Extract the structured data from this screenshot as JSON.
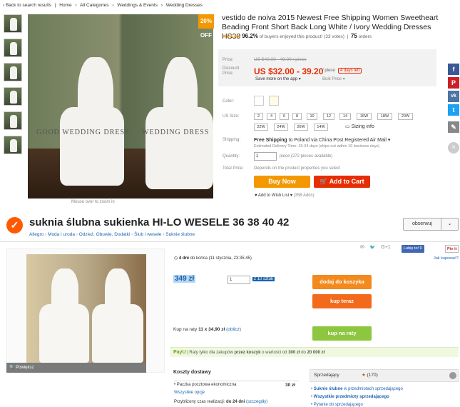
{
  "aliexpress": {
    "breadcrumb": [
      "‹ Back to search results",
      "|",
      "Home",
      "›",
      "All Categories",
      "›",
      "Weddings & Events",
      "›",
      "Wedding Dresses"
    ],
    "discount_badge": "20% OFF",
    "watermarks": [
      "GOOD WEDDING DRESS",
      "WEDDING DRESS"
    ],
    "zoom_hint": "Mouse over to zoom in",
    "title": "vestido de noiva 2015 Newest Free Shipping Women Sweetheart Beading Front Short Back Long White / Ivory Wedding Dresses HS30",
    "rating": {
      "stars": "★★★★★",
      "percent": "96.2%",
      "text": "of buyers enjoyed this product! (33 votes)",
      "orders_count": "75",
      "orders_label": "orders"
    },
    "price": {
      "price_label": "Price:",
      "old": "US $40.00 - 49.00 / piece",
      "discount_label": "Discount Price:",
      "new": "US $32.00 - 39.20",
      "unit": "/ piece",
      "days_left": "4 days left",
      "app_save": "Save more on the app ▾",
      "bulk": "Bulk Price ▾"
    },
    "labels": {
      "color": "Color:",
      "size": "US Size:",
      "shipping": "Shipping:",
      "quantity": "Quantity:",
      "total": "Total Price:"
    },
    "sizes": [
      "2",
      "4",
      "6",
      "8",
      "10",
      "12",
      "14",
      "16W",
      "18W",
      "20W",
      "22W",
      "24W",
      "26W",
      "14W"
    ],
    "size_info": "Sizing info",
    "shipping_main_bold": "Free Shipping",
    "shipping_main_rest": "to Poland via China Post Registered Air Mail ▾",
    "shipping_est": "Estimated Delivery Time: 15-34 days (ships out within 10 business days)",
    "quantity_value": "1",
    "quantity_note": "piece (272 pieces available)",
    "total_note": "Depends on the product properties you select",
    "buy_now": "Buy Now",
    "add_to_cart": "Add to Cart",
    "wish_list": "Add to Wish List ▾",
    "wish_count": "(358 Adds)",
    "social": [
      "f",
      "P",
      "vk",
      "t",
      "✎"
    ]
  },
  "allegro": {
    "title": "suknia ślubna sukienka HI-LO WESELE 36 38 40 42",
    "observe": "obserwuj",
    "crumbs": [
      "Allegro",
      "Moda i uroda",
      "Odzież, Obuwie, Dodatki",
      "Ślub i wesele",
      "Suknie ślubne"
    ],
    "crumb_sep": "›",
    "zoom": "Powiększ",
    "share": [
      "✉",
      "🐦",
      "G+1"
    ],
    "fb_like": "Lubię to! 0",
    "pin_it": "Pin it",
    "how_buy": "Jak kupować?",
    "timer_bold": "4 dni",
    "timer_rest": "do końca (11 stycznia, 23:35:45)",
    "price": "349 zł",
    "qty": "1",
    "qty_of": "z 10 sztuk",
    "add_to_cart": "dodaj do koszyka",
    "buy_now": "kup teraz",
    "inst_text": "Kup na raty",
    "inst_value": "11 x 34,90 zł",
    "inst_link": "(oblicz)",
    "inst_button": "kup na raty",
    "payu_logo": "PayU",
    "payu_text_1": "| Raty tylko dla zakupów",
    "payu_bold": "przez koszyk",
    "payu_text_2": "o wartości od",
    "payu_min": "300 zł",
    "payu_to": "do",
    "payu_max": "20 000 zł",
    "shipping_title": "Koszty dostawy",
    "shipping_method": "• Paczka pocztowa ekonomiczna",
    "shipping_cost": "30 zł",
    "shipping_all": "Wszystkie opcje",
    "shipping_time_label": "Przybliżony czas realizacji:",
    "shipping_time_value": "do 24 dni",
    "shipping_time_link": "(szczegóły)",
    "seller_label": "Sprzedający",
    "seller_rating": "(170)",
    "seller_links": [
      {
        "bold": "Suknie ślubne",
        "rest": " w przedmiotach sprzedającego"
      },
      {
        "bold": "Wszystkie przedmioty sprzedającego",
        "rest": ""
      },
      {
        "bold": "Pytanie do sprzedającego",
        "rest": ""
      }
    ]
  },
  "colors": {
    "aliexpress_orange": "#f39800",
    "aliexpress_red": "#e62e04",
    "allegro_orange": "#ff5a00",
    "allegro_green": "#8dc63f",
    "link_blue": "#1a63b0"
  }
}
